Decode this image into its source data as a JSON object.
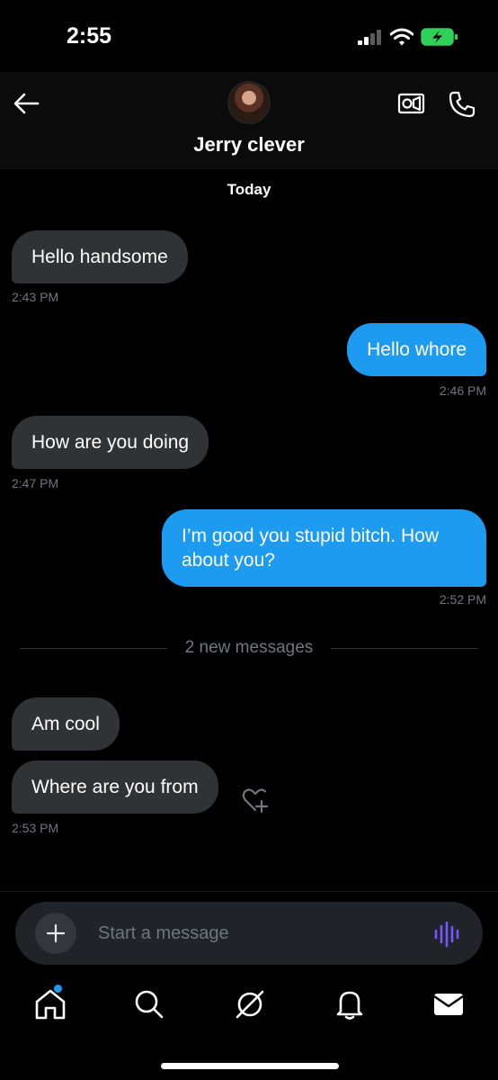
{
  "status": {
    "time": "2:55"
  },
  "header": {
    "contact_name": "Jerry clever"
  },
  "conversation": {
    "date_label": "Today",
    "messages": [
      {
        "direction": "in",
        "text": "Hello handsome",
        "time": "2:43 PM"
      },
      {
        "direction": "out",
        "text": "Hello whore",
        "time": "2:46 PM"
      },
      {
        "direction": "in",
        "text": "How are you doing",
        "time": "2:47 PM"
      },
      {
        "direction": "out",
        "text": "I’m good you stupid bitch. How about you?",
        "time": "2:52 PM"
      },
      {
        "direction": "in",
        "text": "Am cool",
        "time": ""
      },
      {
        "direction": "in",
        "text": "Where are you from",
        "time": "2:53 PM"
      }
    ],
    "new_messages_label": "2 new messages"
  },
  "composer": {
    "placeholder": "Start a message"
  },
  "tabs": [
    "home-icon",
    "search-icon",
    "grok-icon",
    "notifications-icon",
    "messages-icon"
  ],
  "colors": {
    "accent": "#1d9bf0",
    "bubble_in": "#2f3336",
    "voice": "#7856ff"
  }
}
